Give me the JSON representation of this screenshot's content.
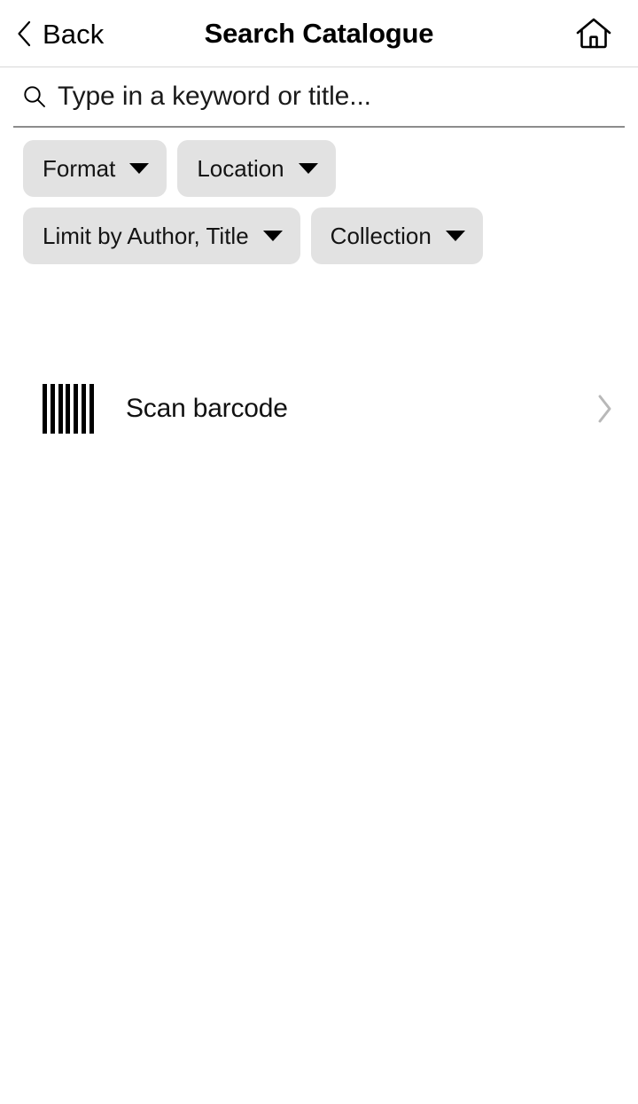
{
  "header": {
    "back_label": "Back",
    "title": "Search Catalogue",
    "back_icon": "chevron-left-icon",
    "home_icon": "home-icon"
  },
  "search": {
    "placeholder": "Type in a keyword or title...",
    "value": "",
    "icon": "search-icon"
  },
  "filters": {
    "chips": [
      {
        "label": "Format",
        "icon": "chevron-down-icon"
      },
      {
        "label": "Location",
        "icon": "chevron-down-icon"
      },
      {
        "label": "Limit by Author, Title",
        "icon": "chevron-down-icon"
      },
      {
        "label": "Collection",
        "icon": "chevron-down-icon"
      }
    ]
  },
  "actions": {
    "scan": {
      "label": "Scan barcode",
      "icon": "barcode-icon",
      "disclosure_icon": "chevron-right-icon",
      "bar_count": 7
    }
  },
  "colors": {
    "background": "#ffffff",
    "chip_fill": "#e2e2e2",
    "text": "#111111",
    "divider": "#d8d8d8",
    "search_underline": "#8c8c8c",
    "disclosure": "#b8b8b8"
  }
}
